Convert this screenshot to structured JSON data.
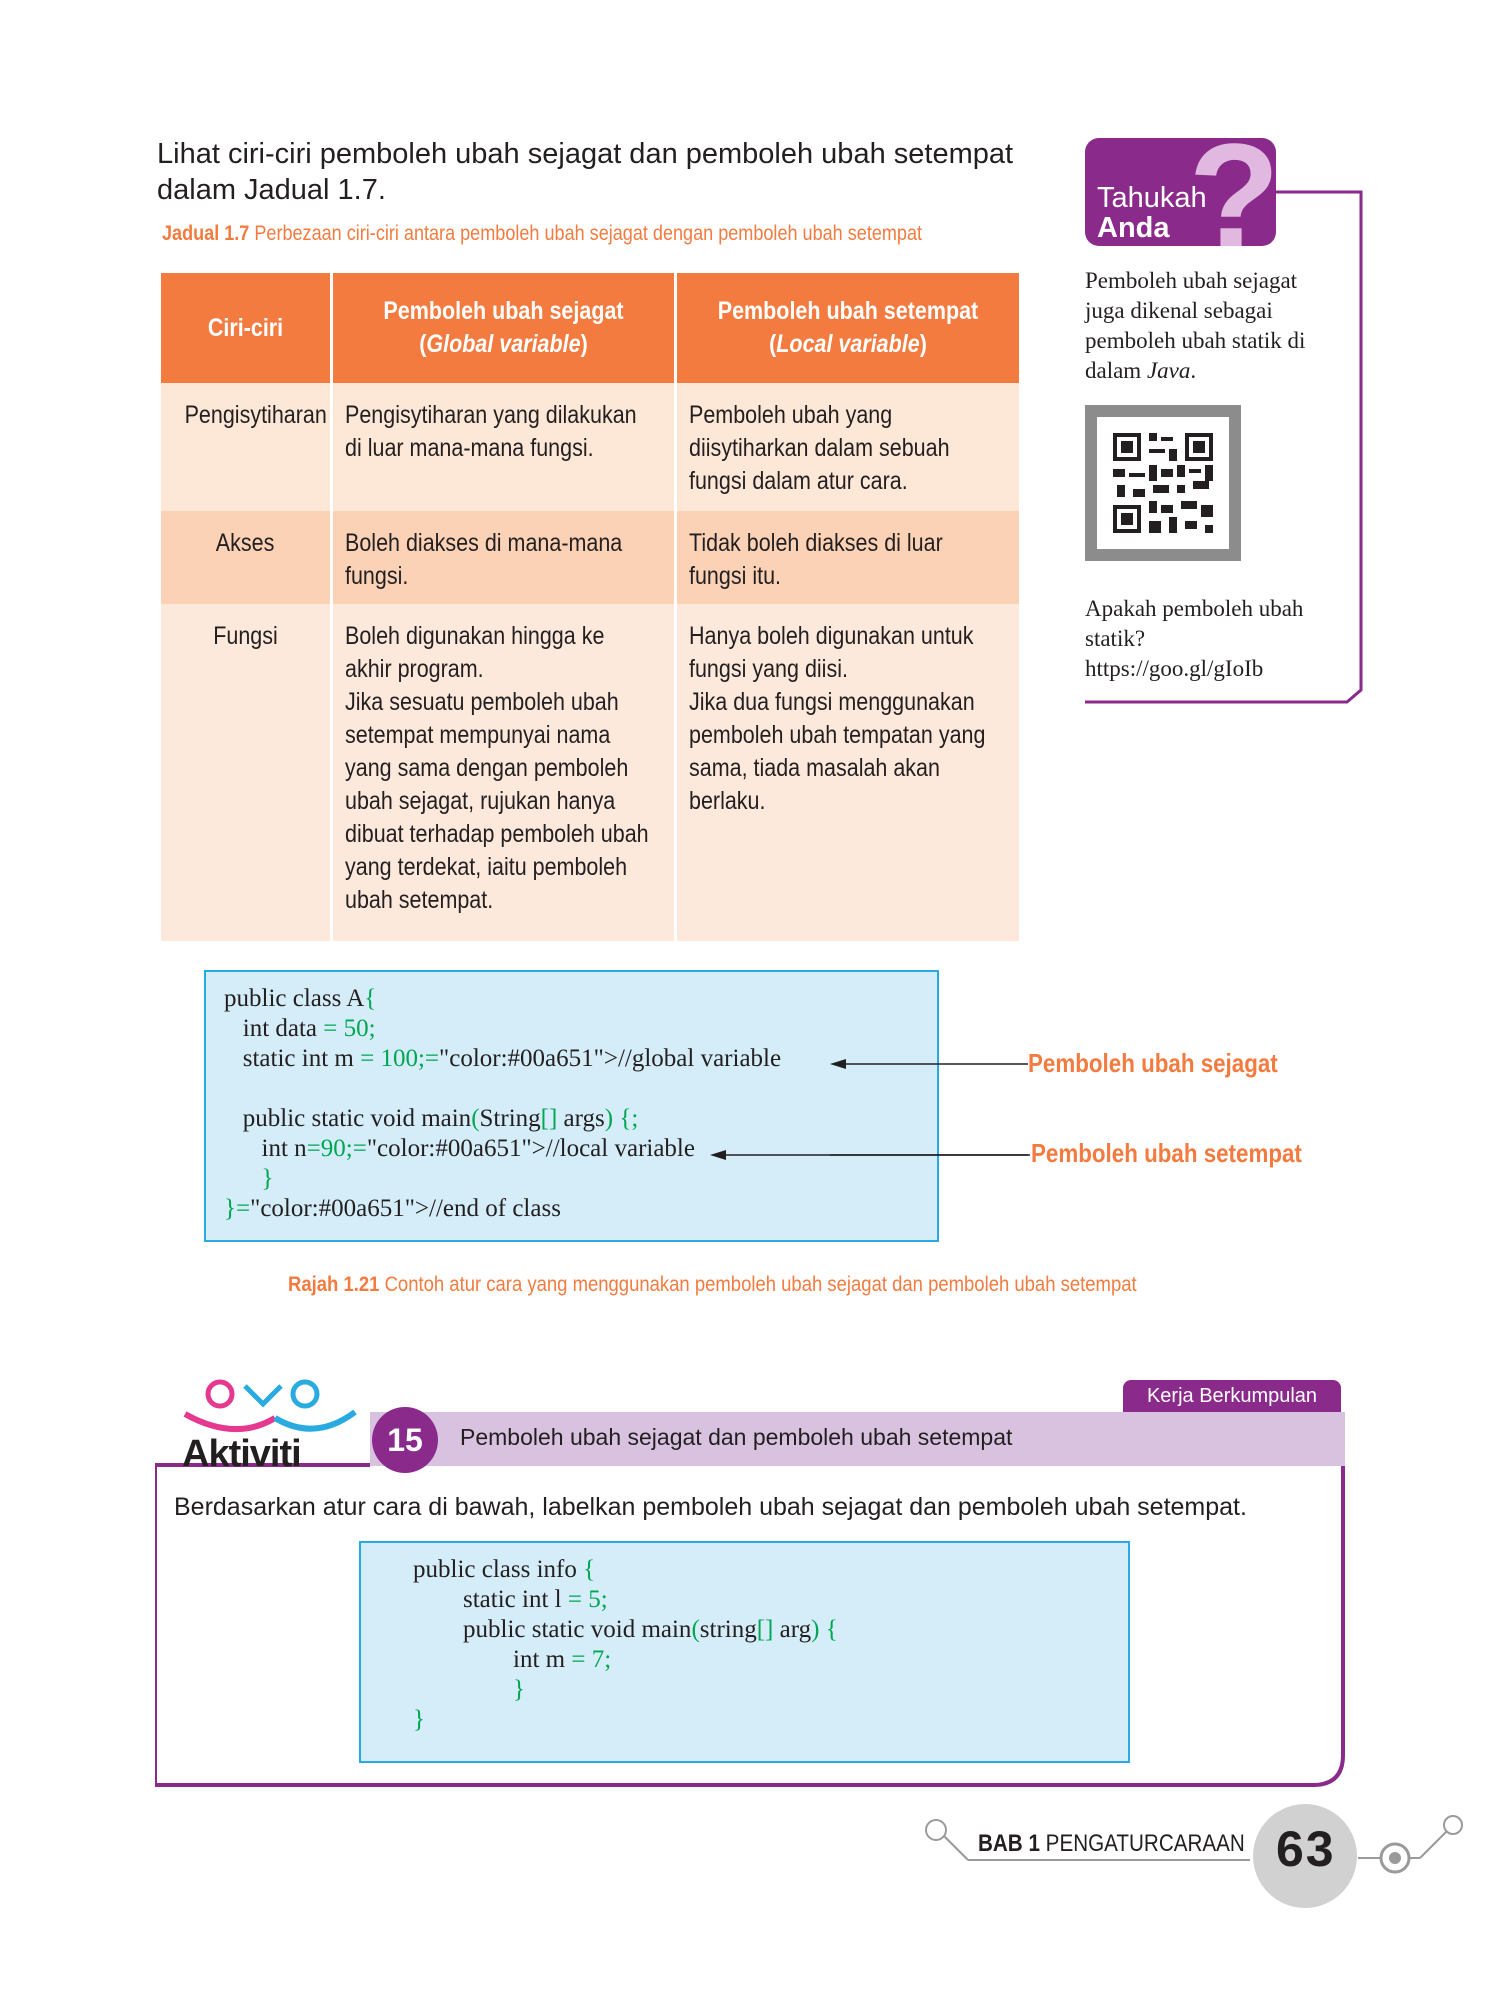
{
  "intro": {
    "text": "Lihat ciri-ciri pemboleh ubah sejagat dan pemboleh ubah setempat dalam Jadual 1.7."
  },
  "table": {
    "caption_label": "Jadual 1.7",
    "caption_text": "Perbezaan ciri-ciri antara pemboleh ubah sejagat dengan pemboleh ubah setempat",
    "headers": {
      "col1": "Ciri-ciri",
      "col2_line1": "Pemboleh ubah sejagat",
      "col2_line2": "Global variable",
      "col3_line1": "Pemboleh ubah setempat",
      "col3_line2": "Local variable"
    },
    "rows": [
      {
        "feature": "Pengisytiharan",
        "global": [
          "Pengisytiharan yang dilakukan",
          "di luar mana-mana fungsi."
        ],
        "local": [
          "Pemboleh ubah yang",
          "diisytiharkan dalam sebuah",
          "fungsi dalam atur cara."
        ]
      },
      {
        "feature": "Akses",
        "global": [
          "Boleh diakses di mana-mana",
          "fungsi."
        ],
        "local": [
          "Tidak boleh diakses di luar",
          "fungsi itu."
        ]
      },
      {
        "feature": "Fungsi",
        "global": [
          "Boleh digunakan hingga ke",
          "akhir program.",
          "Jika sesuatu pemboleh ubah",
          "setempat mempunyai nama",
          "yang sama dengan pemboleh",
          "ubah sejagat, rujukan hanya",
          "dibuat terhadap pemboleh ubah",
          "yang terdekat, iaitu pemboleh",
          "ubah setempat."
        ],
        "local": [
          "Hanya boleh digunakan untuk",
          "fungsi yang diisi.",
          "Jika dua fungsi menggunakan",
          "pemboleh ubah tempatan yang",
          "sama, tiada masalah akan",
          "berlaku."
        ]
      }
    ]
  },
  "sidebar": {
    "badge_line1": "Tahukah",
    "badge_line2": "Anda",
    "badge_glyph": "?",
    "text1": "Pemboleh ubah sejagat juga dikenal sebagai pemboleh ubah statik di dalam",
    "text1_italic": "Java",
    "text1_end": ".",
    "qr_icon": "qr-code-icon",
    "text2": "Apakah pemboleh ubah statik?",
    "link": "https://goo.gl/gIoIb"
  },
  "figure": {
    "code_lines": [
      "public class A{",
      "   int data = 50;",
      "   static int m = 100;//global variable",
      "",
      "   public static void main(String[] args) {;",
      "      int n=90;//local variable",
      "      }",
      "}//end of class"
    ],
    "label_global": "Pemboleh ubah sejagat",
    "label_local": "Pemboleh ubah setempat",
    "caption_label": "Rajah 1.21",
    "caption_text": "Contoh atur cara yang menggunakan pemboleh ubah sejagat dan pemboleh ubah setempat"
  },
  "activity": {
    "logo_text": "Aktiviti",
    "number": "15",
    "title": "Pemboleh ubah sejagat dan pemboleh ubah setempat",
    "tab": "Kerja Berkumpulan",
    "instruction": "Berdasarkan atur cara di bawah, labelkan pemboleh ubah sejagat dan pemboleh ubah setempat.",
    "code_lines": [
      "public class info {",
      "        static int l = 5;",
      "        public static void main(string[] arg) {",
      "                int m = 7;",
      "                }",
      "}"
    ]
  },
  "footer": {
    "chapter_bold": "BAB 1",
    "chapter_text": "PENGATURCARAAN",
    "page_number": "63"
  },
  "colors": {
    "orange": "#f37b3f",
    "purple": "#8a2a8b",
    "lilac": "#d9c2e0",
    "code_bg": "#d4edf9",
    "code_border": "#29abe2",
    "code_green": "#00a651"
  }
}
